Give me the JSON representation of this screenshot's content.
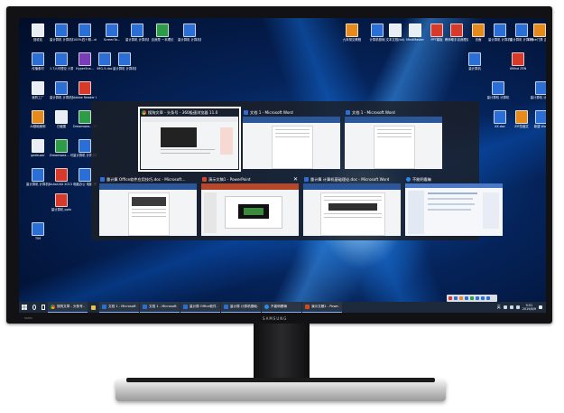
{
  "desktop": {
    "icons_left": [
      {
        "label": "回收站",
        "color": "white"
      },
      {
        "label": "量计算机 计算机基础理论",
        "color": "blue"
      },
      {
        "label": "100%四十期…doc",
        "color": "blue"
      },
      {
        "label": "ScreenTo…",
        "color": "blue"
      },
      {
        "label": "量计算机 计算机基础理论",
        "color": "blue"
      },
      {
        "label": "自我是 一本理论",
        "color": "green"
      },
      {
        "label": "量计算机 计算机基础理论…",
        "color": "blue"
      },
      {
        "label": "传播素材",
        "color": "blue"
      },
      {
        "label": "1.7六可理论 计算机基础…docx",
        "color": "blue"
      },
      {
        "label": "HyperSna…",
        "color": "purple"
      },
      {
        "label": "IMG-5.doc",
        "color": "blue"
      },
      {
        "label": "量计算机 计算机基础理论",
        "color": "blue"
      },
      {
        "label": "我的工厂",
        "color": "white"
      },
      {
        "label": "量计算机 计算机基础理论",
        "color": "blue"
      },
      {
        "label": "Adobe Reader XI",
        "color": "red"
      },
      {
        "label": "AI基础案例",
        "color": "orange"
      },
      {
        "label": "已截图",
        "color": "white"
      },
      {
        "label": "Dreamwea… CC 2019版",
        "color": "green"
      },
      {
        "label": "geekuser",
        "color": "white"
      },
      {
        "label": "Dreamwea… 可视化学习",
        "color": "green"
      },
      {
        "label": "量计算机 计算机基础理论",
        "color": "blue"
      },
      {
        "label": "量计算机 计算机基础理论",
        "color": "blue"
      },
      {
        "label": "AutoCAD 2013 简体",
        "color": "red"
      },
      {
        "label": "电脑办公 电脑 理论 Kobo",
        "color": "blue"
      },
      {
        "label": "量计算机 pptx",
        "color": "red"
      },
      {
        "label": "TIM",
        "color": "blue"
      }
    ],
    "icons_top_right": [
      {
        "label": "九年常见教程",
        "color": "orange"
      },
      {
        "label": "计算机基础",
        "color": "blue"
      },
      {
        "label": "文本文档(txt)",
        "color": "white"
      },
      {
        "label": "MindMaster",
        "color": "white"
      },
      {
        "label": "PPT模板",
        "color": "red"
      },
      {
        "label": "教师助手自我理论.pptx",
        "color": "red"
      },
      {
        "label": "页面",
        "color": "orange"
      },
      {
        "label": "量计算机 计算机基础理论",
        "color": "blue"
      },
      {
        "label": "量计算机 计算机基础理论",
        "color": "blue"
      },
      {
        "label": "Office门禁 正理论版本…",
        "color": "orange"
      },
      {
        "label": "量计算机",
        "color": "blue"
      },
      {
        "label": "XMind ZEN",
        "color": "red"
      },
      {
        "label": "量计算机 计算机",
        "color": "blue"
      },
      {
        "label": "量计算机 计算机",
        "color": "blue"
      },
      {
        "label": "XX.doc",
        "color": "blue"
      },
      {
        "label": "ZIP压缩文",
        "color": "orange"
      },
      {
        "label": "新建 Word",
        "color": "blue"
      },
      {
        "label": "日记本",
        "color": "orange"
      }
    ]
  },
  "task_switcher": {
    "windows": [
      {
        "title": "搜狗文章 - 头条号 - 360极速浏览器 11.0",
        "icon": "chrome",
        "selected": true
      },
      {
        "title": "文档 1 - Microsoft Word",
        "icon": "word",
        "selected": false
      },
      {
        "title": "文档 1 - Microsoft Word",
        "icon": "word",
        "selected": false
      },
      {
        "title": "量计算 Office软件应用技巧.doc - Microsoft…",
        "icon": "word",
        "selected": false
      },
      {
        "title": "演示文稿1 - PowerPoint",
        "icon": "ppt",
        "selected": false
      },
      {
        "title": "量计算 计算机基础理论.doc - Microsoft Word",
        "icon": "word",
        "selected": false
      },
      {
        "title": "不能明看嘛",
        "icon": "edge",
        "selected": false
      }
    ],
    "close_glyph": "✕"
  },
  "taskbar": {
    "start_icon": "windows-logo-icon",
    "buttons": [
      {
        "label": "搜狗文章 - 头条号…",
        "icon": "chrome"
      },
      {
        "label": "",
        "icon": "folder"
      },
      {
        "label": "文档 1 - Microsoft…",
        "icon": "word"
      },
      {
        "label": "文档 1 - Microsoft…",
        "icon": "word"
      },
      {
        "label": "量计算 Office软件…",
        "icon": "word"
      },
      {
        "label": "量计算 计算机基础…",
        "icon": "word"
      },
      {
        "label": "不能明看嘛",
        "icon": "edge"
      },
      {
        "label": "演示文稿1 - Powe…",
        "icon": "ppt"
      }
    ],
    "ime": "英",
    "time": "9:51",
    "date": "2019/8/9"
  },
  "monitor": {
    "brand": "SAMSUNG",
    "badge": "SUHD"
  },
  "colors": {
    "wallpaper_dark": "#010d29",
    "wallpaper_mid": "#0b4aa0",
    "taskbar": "#1d2a3b",
    "switcher_bg": "#1c1e24",
    "word_blue": "#2b579a",
    "ppt_orange": "#d24726"
  }
}
